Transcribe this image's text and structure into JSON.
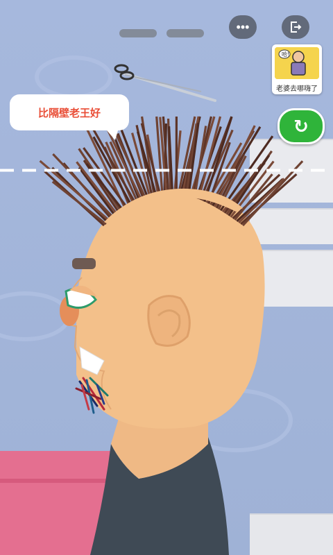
{
  "speech_bubble": {
    "text": "比隔壁老王好"
  },
  "thumbnail": {
    "caption": "老婆去哪嗨了",
    "mini_text": "哈!"
  },
  "buttons": {
    "more_icon": "more-dots-icon",
    "exit_icon": "exit-icon",
    "restart_icon": "restart-icon"
  },
  "colors": {
    "wall": "#a6b8dd",
    "skin": "#f3c08a",
    "hair": "#6a3f2f",
    "pink": "#e46f90",
    "green": "#2fb43a",
    "text_red": "#e94d36"
  }
}
